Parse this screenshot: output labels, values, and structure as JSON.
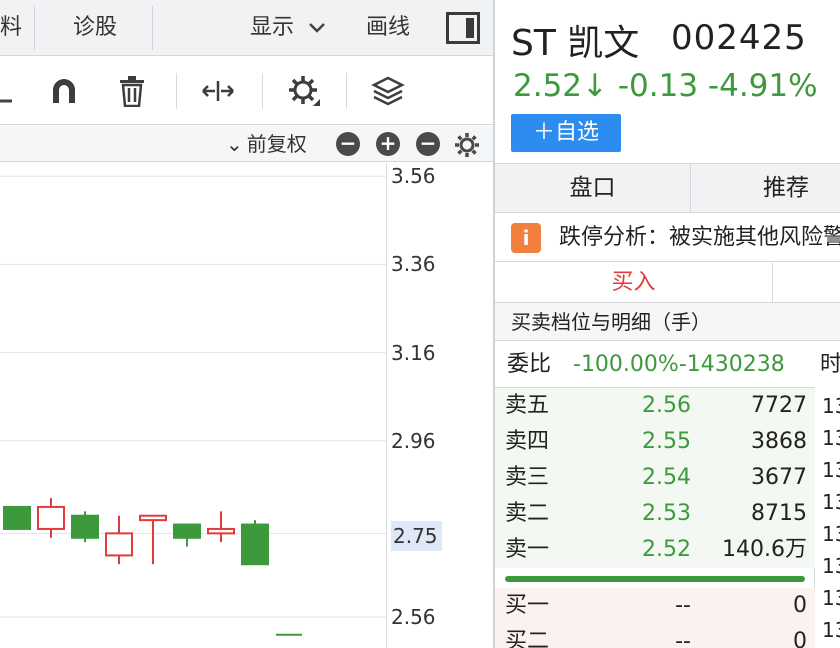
{
  "topbar": {
    "tab_partial": "料",
    "tab_diagnose": "诊股",
    "display_label": "显示",
    "draw_label": "画线"
  },
  "toolbar": {
    "icons": [
      "draw-line-icon",
      "magnet-icon",
      "trash-icon",
      "expand-horizontal-icon",
      "settings-icon",
      "layers-icon"
    ]
  },
  "subbar": {
    "adjust_label": "前复权",
    "chevron": "⌄",
    "zoom_out": "−",
    "zoom_in": "+",
    "collapse": "−"
  },
  "chart_data": {
    "type": "candlestick",
    "y_ticks": [
      "3.56",
      "3.36",
      "3.16",
      "2.96",
      "2.75",
      "2.56"
    ],
    "y_range": [
      2.49,
      3.59
    ],
    "current_price_label": "2.75",
    "colors": {
      "up": "#e23b3b",
      "down": "#3c9a3c",
      "grid": "#e3e4e6"
    },
    "candles": [
      {
        "open": 2.81,
        "close": 2.76,
        "high": 2.81,
        "low": 2.76
      },
      {
        "open": 2.76,
        "close": 2.81,
        "high": 2.83,
        "low": 2.74
      },
      {
        "open": 2.79,
        "close": 2.74,
        "high": 2.8,
        "low": 2.73
      },
      {
        "open": 2.7,
        "close": 2.75,
        "high": 2.79,
        "low": 2.68
      },
      {
        "open": 2.78,
        "close": 2.79,
        "high": 2.79,
        "low": 2.68
      },
      {
        "open": 2.77,
        "close": 2.74,
        "high": 2.77,
        "low": 2.72
      },
      {
        "open": 2.75,
        "close": 2.76,
        "high": 2.8,
        "low": 2.73
      },
      {
        "open": 2.77,
        "close": 2.68,
        "high": 2.78,
        "low": 2.68
      }
    ],
    "partial_mark": 2.52
  },
  "stock": {
    "name": "ST 凯文",
    "code": "002425",
    "price_line": "2.52↓ -0.13 -4.91%",
    "watch_button": "＋自选"
  },
  "tabs": {
    "panel": "盘口",
    "recommend": "推荐"
  },
  "notice": {
    "icon": "i",
    "text": "跌停分析：被实施其他风险警示"
  },
  "trade": {
    "buy": "买入"
  },
  "orderbook": {
    "title": "买卖档位与明细（手）",
    "ratio_label": "委比",
    "ratio_value": "-100.00%-1430238",
    "sells": [
      {
        "label": "卖五",
        "price": "2.56",
        "vol": "7727"
      },
      {
        "label": "卖四",
        "price": "2.55",
        "vol": "3868"
      },
      {
        "label": "卖三",
        "price": "2.54",
        "vol": "3677"
      },
      {
        "label": "卖二",
        "price": "2.53",
        "vol": "8715"
      },
      {
        "label": "卖一",
        "price": "2.52",
        "vol": "140.6万"
      }
    ],
    "buys": [
      {
        "label": "买一",
        "price": "--",
        "vol": "0"
      },
      {
        "label": "买二",
        "price": "--",
        "vol": "0"
      }
    ]
  },
  "ticks_col": {
    "header": "时",
    "rows": [
      "13",
      "13",
      "13",
      "13",
      "13",
      "13",
      "13",
      "13"
    ]
  }
}
